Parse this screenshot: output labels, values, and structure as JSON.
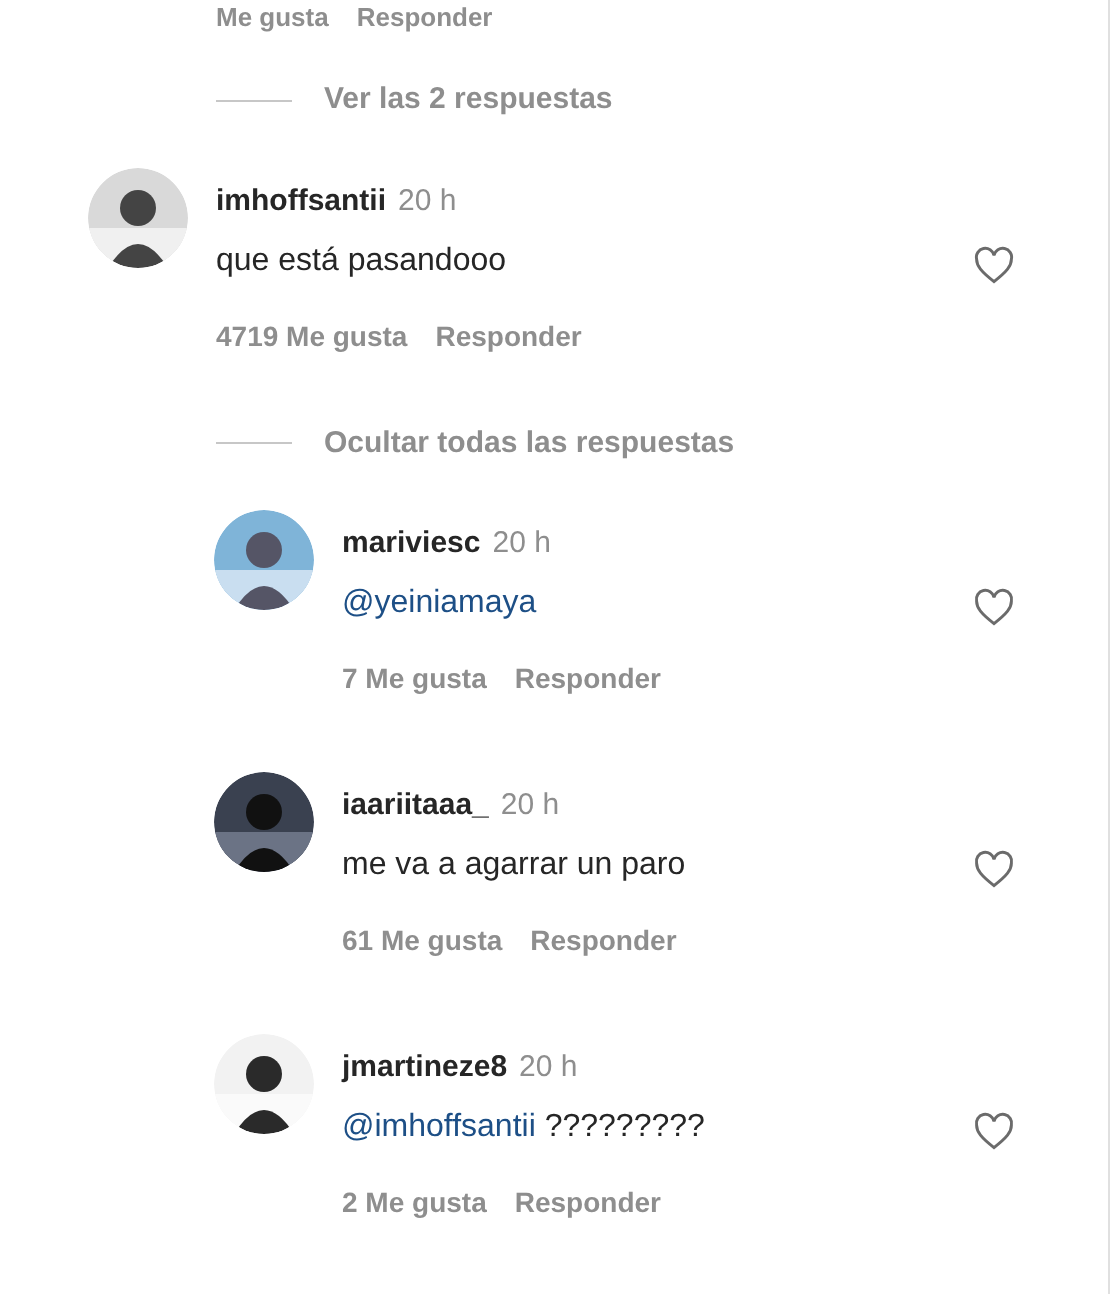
{
  "previous_actions": {
    "likes": "Me gusta",
    "reply": "Responder"
  },
  "view_replies": "Ver las 2 respuestas",
  "comment": {
    "user": "imhoffsantii",
    "time": "20 h",
    "body": [
      {
        "kind": "text",
        "text": "que está pasandooo"
      }
    ],
    "likes": "4719 Me gusta",
    "reply": "Responder",
    "liked": false
  },
  "hide_replies": "Ocultar todas las respuestas",
  "replies": [
    {
      "user": "mariviesc",
      "time": "20 h",
      "body": [
        {
          "kind": "mention",
          "text": "@yeiniamaya"
        }
      ],
      "likes": "7 Me gusta",
      "reply": "Responder",
      "liked": false
    },
    {
      "user": "iaariitaaa_",
      "time": "20 h",
      "body": [
        {
          "kind": "text",
          "text": "me va a agarrar un paro"
        }
      ],
      "likes": "61 Me gusta",
      "reply": "Responder",
      "liked": false
    },
    {
      "user": "jmartineze8",
      "time": "20 h",
      "body": [
        {
          "kind": "mention",
          "text": "@imhoffsantii"
        },
        {
          "kind": "text",
          "text": " ?????????"
        }
      ],
      "likes": "2 Me gusta",
      "reply": "Responder",
      "liked": false
    }
  ]
}
